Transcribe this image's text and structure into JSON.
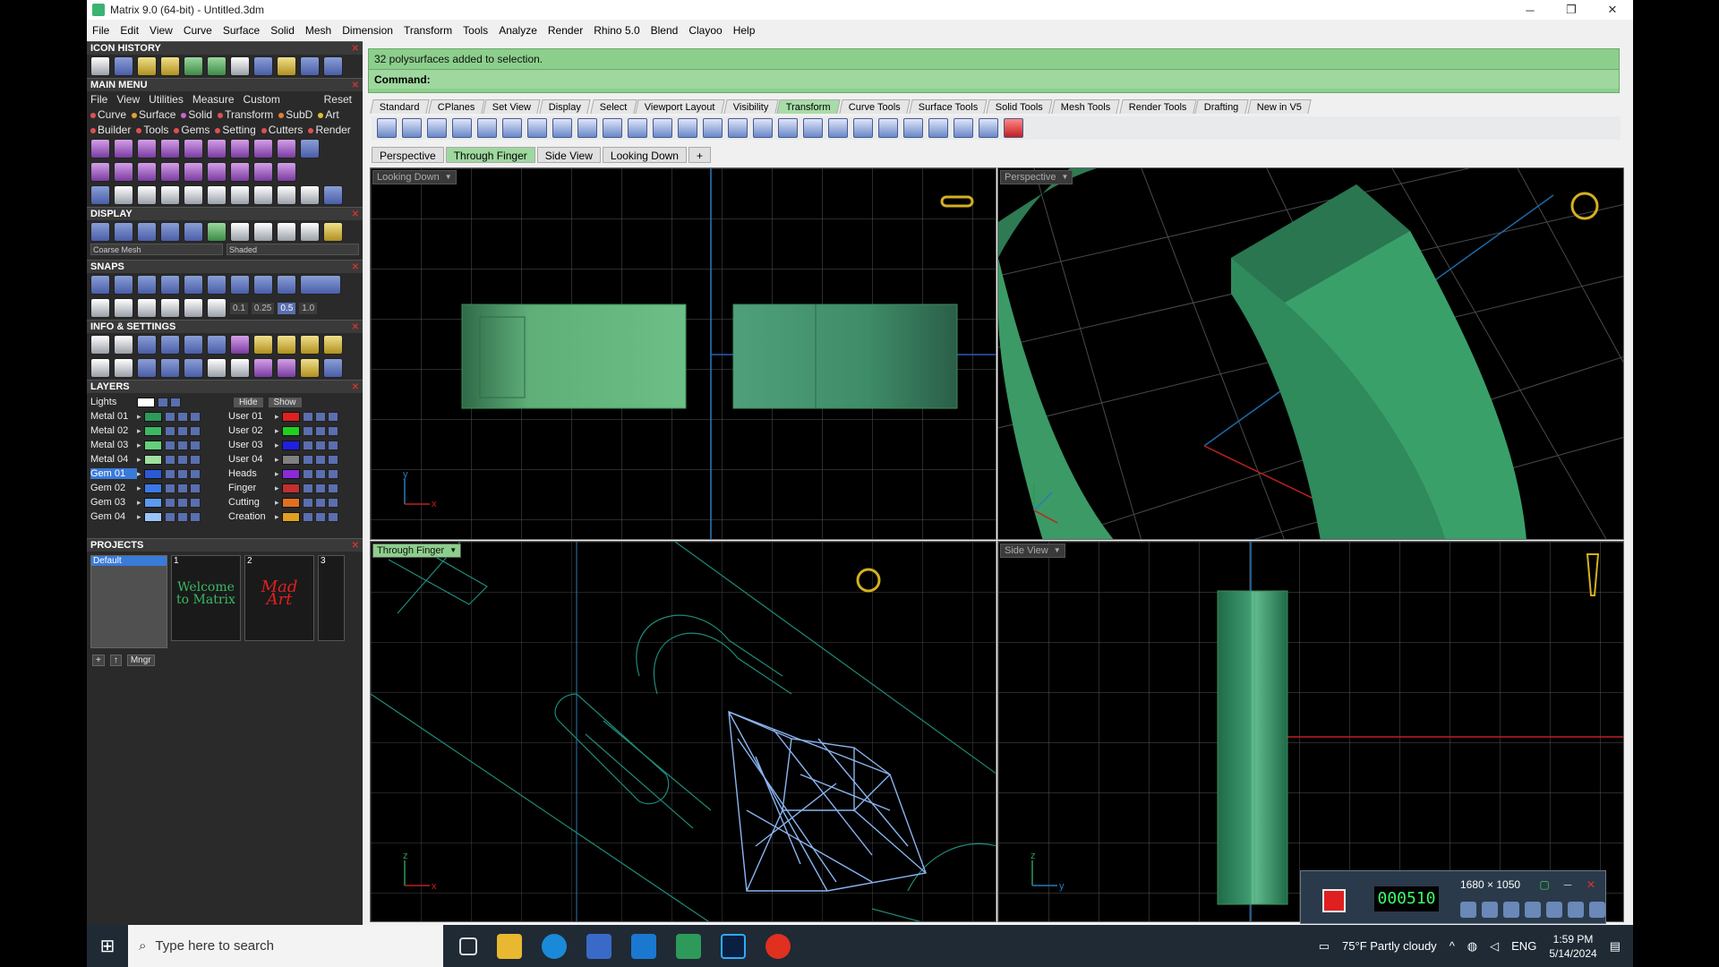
{
  "window": {
    "title": "Matrix 9.0 (64-bit) - Untitled.3dm",
    "controls": [
      "─",
      "❐",
      "✕"
    ]
  },
  "menubar": [
    "File",
    "Edit",
    "View",
    "Curve",
    "Surface",
    "Solid",
    "Mesh",
    "Dimension",
    "Transform",
    "Tools",
    "Analyze",
    "Render",
    "Rhino 5.0",
    "Blend",
    "Clayoo",
    "Help"
  ],
  "panel": {
    "icon_history": "ICON HISTORY",
    "main_menu": "MAIN MENU",
    "main_menu_row1": [
      "File",
      "View",
      "Utilities",
      "Measure",
      "Custom"
    ],
    "reset": "Reset",
    "main_menu_row2": [
      {
        "label": "Curve",
        "color": "#e05050"
      },
      {
        "label": "Surface",
        "color": "#e0a030"
      },
      {
        "label": "Solid",
        "color": "#d060d0"
      },
      {
        "label": "Transform",
        "color": "#e05050"
      },
      {
        "label": "SubD",
        "color": "#e08030"
      },
      {
        "label": "Art",
        "color": "#e0c030"
      }
    ],
    "main_menu_row3": [
      {
        "label": "Builder",
        "color": "#e05050"
      },
      {
        "label": "Tools",
        "color": "#e05050"
      },
      {
        "label": "Gems",
        "color": "#e05050"
      },
      {
        "label": "Setting",
        "color": "#e05050"
      },
      {
        "label": "Cutters",
        "color": "#e05050"
      },
      {
        "label": "Render",
        "color": "#e05050"
      }
    ],
    "display": "DISPLAY",
    "mesh_option": "Coarse Mesh",
    "shade_option": "Shaded",
    "snaps": "SNAPS",
    "snap_values": [
      "0.1",
      "0.25",
      "0.5",
      "1.0"
    ],
    "info_settings": "INFO & SETTINGS",
    "layers": "LAYERS",
    "lights": "Lights",
    "hide": "Hide",
    "show": "Show",
    "layers_left": [
      {
        "name": "Metal 01",
        "color": "#2e9a5a"
      },
      {
        "name": "Metal 02",
        "color": "#3cb864"
      },
      {
        "name": "Metal 03",
        "color": "#64d07a"
      },
      {
        "name": "Metal 04",
        "color": "#9ee0a0"
      },
      {
        "name": "Gem 01",
        "color": "#2a5ad8",
        "selected": true
      },
      {
        "name": "Gem 02",
        "color": "#3a7ae8"
      },
      {
        "name": "Gem 03",
        "color": "#5a9af0"
      },
      {
        "name": "Gem 04",
        "color": "#9ac4f8"
      }
    ],
    "layers_right": [
      {
        "name": "User 01",
        "color": "#e02020"
      },
      {
        "name": "User 02",
        "color": "#20d020"
      },
      {
        "name": "User 03",
        "color": "#2020e0"
      },
      {
        "name": "User 04",
        "color": "#808080"
      },
      {
        "name": "Heads",
        "color": "#8a2ad8"
      },
      {
        "name": "Finger",
        "color": "#c03030"
      },
      {
        "name": "Cutting",
        "color": "#e07020"
      },
      {
        "name": "Creation",
        "color": "#e0a020"
      }
    ],
    "projects": "PROJECTS",
    "project_default": "Default",
    "project_cards": [
      {
        "num": "1",
        "text": "Welcome to Matrix",
        "color": "#3cb864"
      },
      {
        "num": "2",
        "text": "Mad Art",
        "color": "#e02020"
      },
      {
        "num": "3",
        "text": "",
        "color": "#ffffff"
      }
    ],
    "project_tools": [
      "+",
      "↑",
      "Mngr"
    ]
  },
  "message": {
    "line": "32 polysurfaces added to selection.",
    "command_label": "Command:"
  },
  "toolbar_tabs": [
    "Standard",
    "CPlanes",
    "Set View",
    "Display",
    "Select",
    "Viewport Layout",
    "Visibility",
    "Transform",
    "Curve Tools",
    "Surface Tools",
    "Solid Tools",
    "Mesh Tools",
    "Render Tools",
    "Drafting",
    "New in V5"
  ],
  "toolbar_active": "Transform",
  "view_tabs": [
    "Perspective",
    "Through Finger",
    "Side View",
    "Looking Down"
  ],
  "view_active": "Through Finger",
  "viewports": {
    "top_left": "Looking Down",
    "top_right": "Perspective",
    "bottom_left": "Through Finger",
    "bottom_right": "Side View"
  },
  "axis_labels": {
    "y": "y",
    "x": "x",
    "z": "z"
  },
  "recorder": {
    "timer": "000510",
    "resolution": "1680 × 1050"
  },
  "taskbar": {
    "search_placeholder": "Type here to search",
    "weather": "75°F  Partly cloudy",
    "language": "ENG",
    "time": "1:59 PM",
    "date": "5/14/2024"
  }
}
